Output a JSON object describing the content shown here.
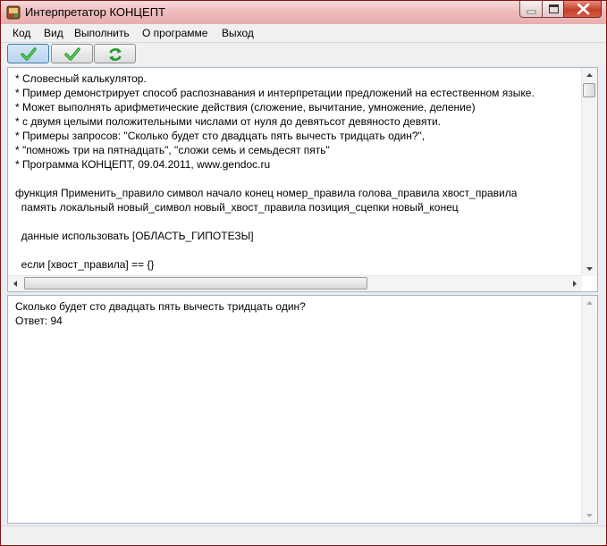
{
  "window": {
    "title": "Интерпретатор КОНЦЕПТ",
    "title_bar_color": "#eebcbc",
    "close_button_color": "#c6402c"
  },
  "menu": [
    "Код",
    "Вид",
    "Выполнить",
    "О программе",
    "Выход"
  ],
  "toolbar": {
    "buttons": [
      {
        "icon": "checkmark-icon",
        "state": "pressed"
      },
      {
        "icon": "checkmark-icon",
        "state": "normal"
      },
      {
        "icon": "refresh-icon",
        "state": "normal"
      }
    ],
    "icon_color": "#1f9a2a"
  },
  "code_editor": {
    "lines": [
      "* Словесный калькулятор.",
      "* Пример демонстрирует способ распознавания и интерпретации предложений на естественном языке.",
      "* Может выполнять арифметические действия (сложение, вычитание, умножение, деление)",
      "* с двумя целыми положительными числами от нуля до девятьсот девяносто девяти.",
      "* Примеры запросов: \"Сколько будет сто двадцать пять вычесть тридцать один?\",",
      "* \"помножь три на пятнадцать\", \"сложи семь и семьдесят пять\"",
      "* Программа КОНЦЕПТ, 09.04.2011, www.gendoc.ru",
      "",
      "функция Применить_правило символ начало конец номер_правила голова_правила хвост_правила",
      "  память локальный новый_символ новый_хвост_правила позиция_сцепки новый_конец",
      "",
      "  данные использовать [ОБЛАСТЬ_ГИПОТЕЗЫ]",
      "",
      "  если [хвост_правила] == {}"
    ]
  },
  "output": {
    "lines": [
      "Сколько будет сто двадцать пять вычесть тридцать один?",
      "Ответ: 94"
    ]
  }
}
